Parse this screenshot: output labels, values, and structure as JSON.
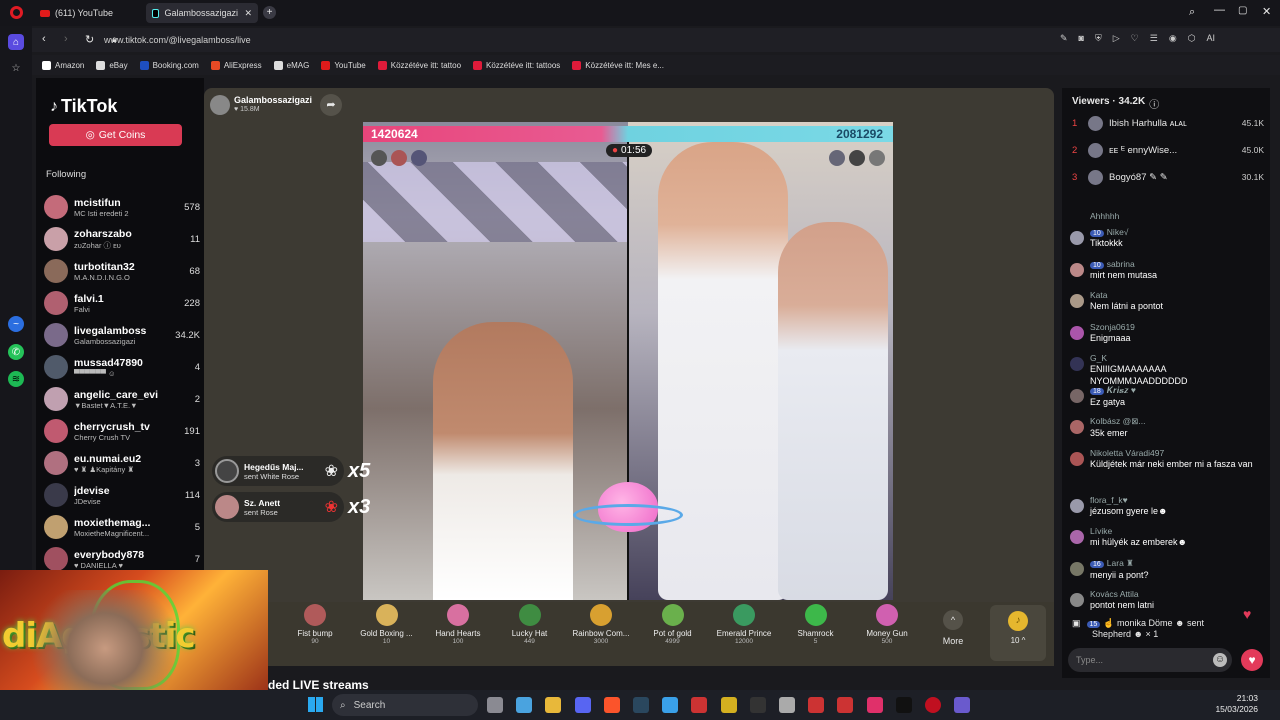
{
  "browser": {
    "tabs": [
      {
        "label": "(611) YouTube"
      },
      {
        "label": "Galambossazigazi (@..."
      }
    ],
    "url": "www.tiktok.com/@livegalamboss/live",
    "bookmarks": [
      {
        "label": "Amazon",
        "color": "#ffffff"
      },
      {
        "label": "eBay",
        "color": "#dddddd"
      },
      {
        "label": "Booking.com",
        "color": "#1e4fbf"
      },
      {
        "label": "AliExpress",
        "color": "#e84a25"
      },
      {
        "label": "eMAG",
        "color": "#dddddd"
      },
      {
        "label": "YouTube",
        "color": "#e01b1b"
      },
      {
        "label": "Közzétéve itt: tattoo",
        "color": "#e01b3a"
      },
      {
        "label": "Közzétéve itt: tattoos",
        "color": "#e01b3a"
      },
      {
        "label": "Közzétéve itt: Mes e...",
        "color": "#e01b3a"
      }
    ],
    "ai_label": "AI"
  },
  "tiktok": {
    "logo": "TikTok",
    "get_coins": "Get Coins",
    "following_label": "Following",
    "following": [
      {
        "name": "mcistifun",
        "sub": "MC Isti eredeti 2",
        "count": "578"
      },
      {
        "name": "zoharszabo",
        "sub": "ᴢᴜZohar ⓘ ᴇᴜ",
        "count": "11"
      },
      {
        "name": "turbotitan32",
        "sub": "M.A.N.D.I.N.G.O",
        "count": "68"
      },
      {
        "name": "falvi.1",
        "sub": "Falvi",
        "count": "228"
      },
      {
        "name": "livegalamboss",
        "sub": "Galambossazigazi",
        "count": "34.2K"
      },
      {
        "name": "mussad47890",
        "sub": "▀▀▀▀▀▀ ☺",
        "count": "4"
      },
      {
        "name": "angelic_care_evi",
        "sub": "▼Bastet▼A.T.E.▼",
        "count": "2"
      },
      {
        "name": "cherrycrush_tv",
        "sub": "Cherry Crush TV",
        "count": "191"
      },
      {
        "name": "eu.numai.eu2",
        "sub": "♥ ♜ ♟Kapitány ♜",
        "count": "3"
      },
      {
        "name": "jdevise",
        "sub": "JDevise",
        "count": "114"
      },
      {
        "name": "moxiethemag...",
        "sub": "MoxietheMagnificent...",
        "count": "5"
      },
      {
        "name": "everybody878",
        "sub": "♥ DANIELLA ♥",
        "count": "7"
      }
    ],
    "recommended": "ded LIVE streams"
  },
  "stream": {
    "host_name": "Galambossazigazi",
    "host_likes": "♥ 15.8M",
    "pk_left": "1420624",
    "pk_right": "2081292",
    "timer": "01:56",
    "notices": [
      {
        "name": "Hegedűs Maj...",
        "action": "sent White Rose",
        "mult": "x5"
      },
      {
        "name": "Sz. Anett",
        "action": "sent Rose",
        "mult": "x3"
      }
    ],
    "gifts": [
      {
        "name": "Fist bump",
        "cost": "90",
        "color": "#b05a5a"
      },
      {
        "name": "Gold Boxing ...",
        "cost": "10",
        "color": "#d9b25a"
      },
      {
        "name": "Hand Hearts",
        "cost": "100",
        "color": "#d870a0"
      },
      {
        "name": "Lucky Hat",
        "cost": "449",
        "color": "#3f8c42"
      },
      {
        "name": "Rainbow Com...",
        "cost": "3000",
        "color": "#d8a030"
      },
      {
        "name": "Pot of gold",
        "cost": "4999",
        "color": "#6ab04c"
      },
      {
        "name": "Emerald Prince",
        "cost": "12000",
        "color": "#3a9a60"
      },
      {
        "name": "Shamrock",
        "cost": "5",
        "color": "#3db84a"
      },
      {
        "name": "Money Gun",
        "cost": "500",
        "color": "#d060b0"
      }
    ],
    "more_label": "More",
    "coin_label": "10 ^"
  },
  "viewers": {
    "title": "Viewers · 34.2K",
    "top": [
      {
        "rank": "1",
        "name": "Ibish Harhulla ᴀʟᴀʟ",
        "score": "45.1K"
      },
      {
        "rank": "2",
        "name": "ᴇᴇ ᴱ ennyWise...",
        "score": "45.0K"
      },
      {
        "rank": "3",
        "name": "Bogyó87 ✎ ✎",
        "score": "30.1K"
      }
    ]
  },
  "chat": {
    "messages": [
      {
        "user": "Ahhhhh",
        "level": "",
        "msg": ""
      },
      {
        "user": "Nike√",
        "level": "10",
        "msg": "Tiktokkk"
      },
      {
        "user": "sabrina",
        "level": "10",
        "msg": "mirt nem mutasa"
      },
      {
        "user": "Kata",
        "level": "",
        "msg": "Nem látni a pontot"
      },
      {
        "user": "Szonja0619",
        "level": "",
        "msg": "Enigmaaa"
      },
      {
        "user": "G_K",
        "level": "",
        "msg": "ENIIIGMAAAAAAA NYOMMMJAADDDDDD"
      },
      {
        "user": "𝑲𝒓𝒊𝒔𝒛 ♥",
        "level": "18",
        "msg": "Ez gatya"
      },
      {
        "user": "Kolbász @⊠...",
        "level": "",
        "msg": "35k emer"
      },
      {
        "user": "Nikoletta Váradi497",
        "level": "",
        "msg": "Küldjétek már neki ember mi a fasza van"
      },
      {
        "user": "flora_f_k♥",
        "level": "",
        "msg": "jézusom gyere le☻"
      },
      {
        "user": "Lívike",
        "level": "",
        "msg": "mi hülyék az emberek☻"
      },
      {
        "user": "Lara ♜",
        "level": "16",
        "msg": "menyii a pont?"
      },
      {
        "user": "Kovács Attila",
        "level": "",
        "msg": "pontot nem latni"
      }
    ],
    "gift_line": "☝ monika Döme ☻ sent",
    "gift_line2": "Shepherd ☻ × 1",
    "gift_level": "15",
    "placeholder": "Type..."
  },
  "overlay": {
    "logo_text": "diAgnostic"
  },
  "taskbar": {
    "search": "Search",
    "time": "21:03",
    "date": "15/03/2026"
  }
}
